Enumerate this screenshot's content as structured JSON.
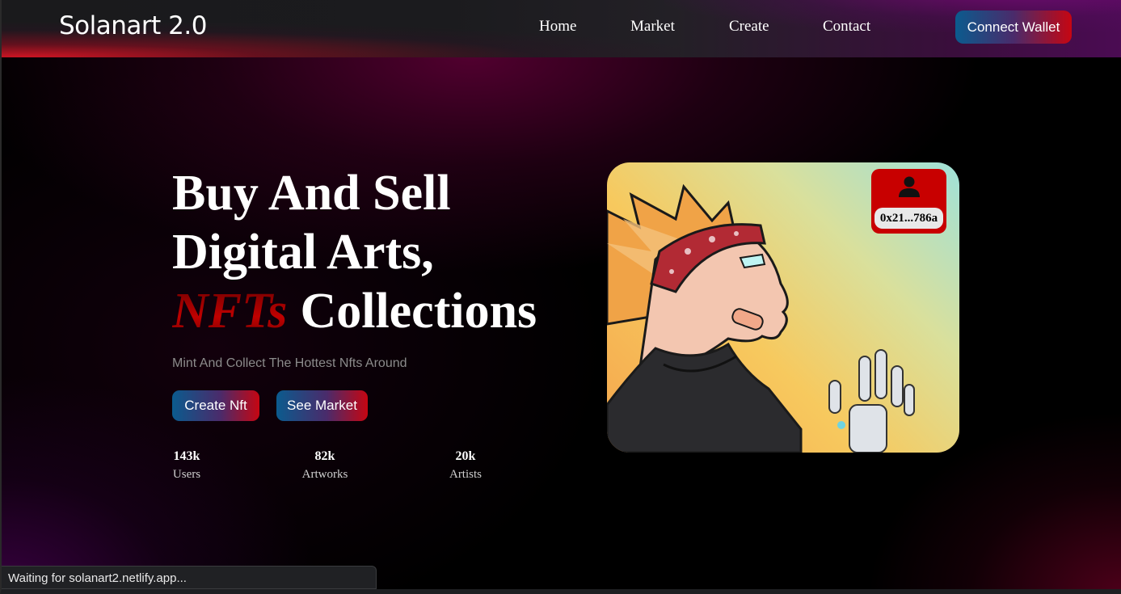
{
  "nav": {
    "logo": "Solanart 2.0",
    "links": [
      {
        "label": "Home"
      },
      {
        "label": "Market"
      },
      {
        "label": "Create"
      },
      {
        "label": "Contact"
      }
    ],
    "connect_label": "Connect Wallet"
  },
  "hero": {
    "line1": "Buy And Sell",
    "line2": "Digital Arts,",
    "line3_accent": "NFTs",
    "line3_rest": "Collections",
    "subtitle": "Mint And Collect The Hottest Nfts Around",
    "create_label": "Create Nft",
    "market_label": "See Market",
    "stats": [
      {
        "value": "143k",
        "label": "Users"
      },
      {
        "value": "82k",
        "label": "Artworks"
      },
      {
        "value": "20k",
        "label": "Artists"
      }
    ]
  },
  "card": {
    "owner_icon": "user-icon",
    "owner_address": "0x21...786a"
  },
  "status_bar": {
    "text": "Waiting for solanart2.netlify.app..."
  },
  "colors": {
    "accent_red": "#c80000",
    "accent_blue": "#0b5b8e",
    "nft_red": "#a00000"
  }
}
